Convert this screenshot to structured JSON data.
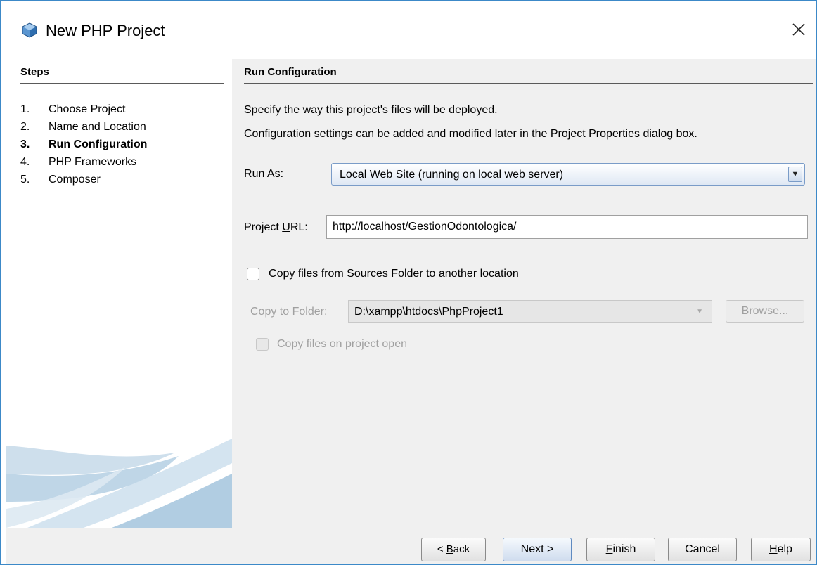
{
  "window": {
    "title": "New PHP Project"
  },
  "steps": {
    "heading": "Steps",
    "items": [
      {
        "num": "1.",
        "label": "Choose Project",
        "current": false
      },
      {
        "num": "2.",
        "label": "Name and Location",
        "current": false
      },
      {
        "num": "3.",
        "label": "Run Configuration",
        "current": true
      },
      {
        "num": "4.",
        "label": "PHP Frameworks",
        "current": false
      },
      {
        "num": "5.",
        "label": "Composer",
        "current": false
      }
    ]
  },
  "run_config": {
    "heading": "Run Configuration",
    "desc1": "Specify the way this project's files will be deployed.",
    "desc2": "Configuration settings can be added and modified later in the Project Properties dialog box.",
    "run_as": {
      "label_mn": "R",
      "label_rest": "un As:",
      "value": "Local Web Site (running on local web server)"
    },
    "project_url": {
      "label_pre": "Project ",
      "label_mn": "U",
      "label_post": "RL:",
      "value": "http://localhost/GestionOdontologica/"
    },
    "copy_files": {
      "label_mn": "C",
      "label_rest": "opy files from Sources Folder to another location",
      "checked": false
    },
    "copy_to_folder": {
      "label_pre": "Copy to Fo",
      "label_mn": "l",
      "label_post": "der:",
      "value": "D:\\xampp\\htdocs\\PhpProject1",
      "enabled": false
    },
    "browse": {
      "label": "Browse...",
      "enabled": false
    },
    "copy_on_open": {
      "label": "Copy files on project open",
      "checked": false,
      "enabled": false
    }
  },
  "buttons": {
    "back": {
      "pre": "< ",
      "mn": "B",
      "post": "ack"
    },
    "next": {
      "label": "Next >"
    },
    "finish": {
      "mn": "F",
      "post": "inish"
    },
    "cancel": {
      "label": "Cancel"
    },
    "help": {
      "mn": "H",
      "post": "elp"
    }
  },
  "colors": {
    "window_border": "#3c89c8",
    "panel_bg": "#f0f0f0",
    "accent": "#7a9cc8"
  }
}
